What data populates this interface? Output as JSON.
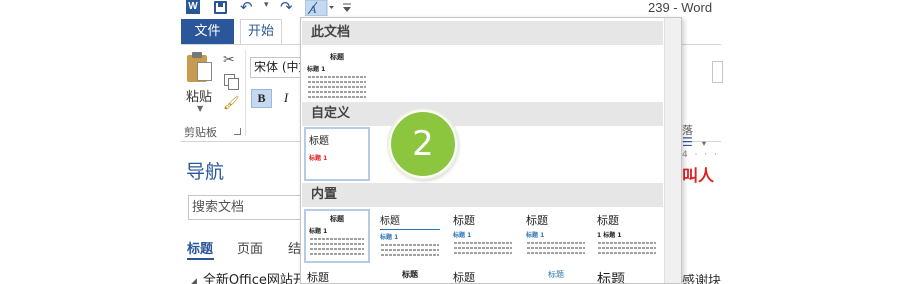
{
  "titlebar": {
    "word_logo": "W",
    "doc_title": "239 - Word"
  },
  "ribbon": {
    "tab_file": "文件",
    "tab_home": "开始",
    "paste_label": "粘贴",
    "clipboard_group": "剪贴板",
    "font_name": "宋体 (中文",
    "bold": "B",
    "italic": "I",
    "right_group_fragment": "落",
    "right_ruler_fragment": "4 · · ·",
    "right_red_fragment": "叫人",
    "right_text_fragment": "感谢块"
  },
  "nav": {
    "title": "导航",
    "search_value": "搜索文档",
    "tabs": [
      "标题",
      "页面",
      "结"
    ],
    "first_item": "全新Office网站开"
  },
  "gallery": {
    "sections": {
      "this_doc": "此文档",
      "custom": "自定义",
      "builtin": "内置"
    },
    "this_doc_thumb": {
      "title": "标题",
      "sub": "标题 1"
    },
    "custom_thumb": {
      "title": "标题",
      "sub": "标题 1"
    },
    "builtin_row1": [
      {
        "title": "标题",
        "sub": "标题 1"
      },
      {
        "title": "标题",
        "sub": "标题 1"
      },
      {
        "title": "标题",
        "sub": "标题 1"
      },
      {
        "title": "标题",
        "sub": "标题 1"
      },
      {
        "title": "标题",
        "sub": "1 标题 1"
      }
    ],
    "builtin_row2": [
      {
        "title": "标题"
      },
      {
        "title": "标题"
      },
      {
        "title": "标题"
      },
      {
        "title": "标题"
      },
      {
        "title": "标题"
      }
    ]
  },
  "callout": {
    "number": "2",
    "color": "#8cc63f"
  },
  "colors": {
    "accent": "#2b579a",
    "heading_red": "#e02020",
    "heading_blue": "#2e74b5"
  },
  "icons": [
    "word-logo-icon",
    "save-icon",
    "undo-icon",
    "redo-icon",
    "style-set-icon",
    "paste-icon",
    "cut-icon",
    "copy-icon",
    "format-painter-icon",
    "dialog-launcher-icon"
  ]
}
